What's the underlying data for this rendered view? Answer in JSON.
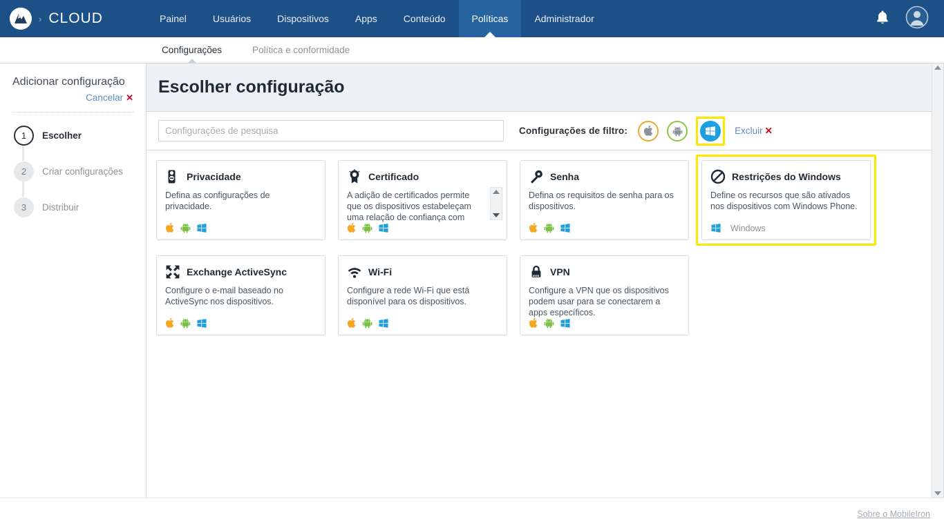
{
  "header": {
    "brand_separator": "›",
    "brand": "CLOUD",
    "logo_icon": "mobileiron-logo-icon",
    "nav": [
      {
        "label": "Painel",
        "active": false
      },
      {
        "label": "Usuários",
        "active": false
      },
      {
        "label": "Dispositivos",
        "active": false
      },
      {
        "label": "Apps",
        "active": false
      },
      {
        "label": "Conteúdo",
        "active": false
      },
      {
        "label": "Políticas",
        "active": true
      },
      {
        "label": "Administrador",
        "active": false
      }
    ],
    "notifications_icon": "bell-icon",
    "account_icon": "user-avatar-icon",
    "background_color": "#1d5087",
    "active_tab_color": "#27639f"
  },
  "subtabs": [
    {
      "label": "Configurações",
      "active": true
    },
    {
      "label": "Política e conformidade",
      "active": false
    }
  ],
  "sidebar": {
    "title": "Adicionar configuração",
    "cancel_label": "Cancelar",
    "cancel_icon": "close-x-icon",
    "steps": [
      {
        "number": "1",
        "label": "Escolher",
        "active": true
      },
      {
        "number": "2",
        "label": "Criar configurações",
        "active": false
      },
      {
        "number": "3",
        "label": "Distribuir",
        "active": false
      }
    ]
  },
  "main": {
    "page_title": "Escolher configuração",
    "search": {
      "placeholder": "Configurações de pesquisa",
      "value": ""
    },
    "filter": {
      "label": "Configurações de filtro:",
      "platforms": [
        {
          "name": "apple",
          "icon": "apple-icon",
          "selected": false,
          "color": "#f0a830"
        },
        {
          "name": "android",
          "icon": "android-icon",
          "selected": false,
          "color": "#8cc63e"
        },
        {
          "name": "windows",
          "icon": "windows-icon",
          "selected": true,
          "color": "#1ea0e0"
        }
      ],
      "clear_label": "Excluir",
      "clear_icon": "close-x-icon",
      "highlight_color": "#ffe600"
    },
    "cards": [
      {
        "title": "Privacidade",
        "icon": "privacy-doorhanger-icon",
        "description": "Defina as configurações de privacidade.",
        "platforms": [
          "apple",
          "android",
          "windows"
        ],
        "selected": false,
        "has_scrollbar": false,
        "platform_label": ""
      },
      {
        "title": "Certificado",
        "icon": "certificate-ribbon-icon",
        "description": "A adição de certificados permite que os dispositivos estabeleçam uma relação de confiança com servidores e redes",
        "platforms": [
          "apple",
          "android",
          "windows"
        ],
        "selected": false,
        "has_scrollbar": true,
        "platform_label": ""
      },
      {
        "title": "Senha",
        "icon": "key-icon",
        "description": "Defina os requisitos de senha para os dispositivos.",
        "platforms": [
          "apple",
          "android",
          "windows"
        ],
        "selected": false,
        "has_scrollbar": false,
        "platform_label": ""
      },
      {
        "title": "Restrições do Windows",
        "icon": "prohibition-icon",
        "description": "Define os recursos que são ativados nos dispositivos com Windows Phone.",
        "platforms": [
          "windows"
        ],
        "selected": true,
        "has_scrollbar": false,
        "platform_label": "Windows"
      },
      {
        "title": "Exchange ActiveSync",
        "icon": "sync-arrows-icon",
        "description": "Configure o e-mail baseado no ActiveSync nos dispositivos.",
        "platforms": [
          "apple",
          "android",
          "windows"
        ],
        "selected": false,
        "has_scrollbar": false,
        "platform_label": ""
      },
      {
        "title": "Wi-Fi",
        "icon": "wifi-icon",
        "description": "Configure a rede Wi-Fi que está disponível para os dispositivos.",
        "platforms": [
          "apple",
          "android",
          "windows"
        ],
        "selected": false,
        "has_scrollbar": false,
        "platform_label": ""
      },
      {
        "title": "VPN",
        "icon": "lock-icon",
        "description": "Configure a VPN que os dispositivos podem usar para se conectarem a apps específicos.",
        "platforms": [
          "apple",
          "android",
          "windows"
        ],
        "selected": false,
        "has_scrollbar": false,
        "platform_label": ""
      }
    ]
  },
  "footer": {
    "about_label": "Sobre o MobileIron"
  }
}
